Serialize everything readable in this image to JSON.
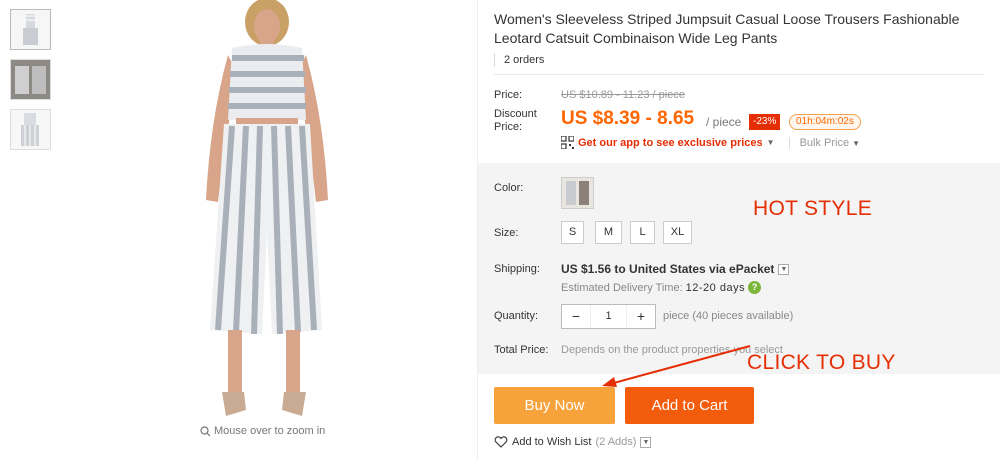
{
  "product": {
    "title": "Women's Sleeveless Striped Jumpsuit Casual Loose Trousers Fashionable Leotard Catsuit Combinaison Wide Leg Pants",
    "orders": "2 orders"
  },
  "gallery": {
    "zoom_hint": "Mouse over to zoom in"
  },
  "pricing": {
    "price_label": "Price:",
    "old_price": "US $10.89 - 11.23 / piece",
    "discount_label": "Discount Price:",
    "new_price": "US $8.39 - 8.65",
    "per_piece": "/ piece",
    "discount_badge": "-23%",
    "timer": "01h:04m:02s",
    "app_promo": "Get our app to see exclusive prices",
    "bulk_price": "Bulk Price"
  },
  "options": {
    "color_label": "Color:",
    "size_label": "Size:",
    "sizes": [
      "S",
      "M",
      "L",
      "XL"
    ],
    "shipping_label": "Shipping:",
    "shipping_value": "US $1.56 to United States via ePacket",
    "delivery_label": "Estimated Delivery Time:",
    "delivery_days": "12-20 days",
    "quantity_label": "Quantity:",
    "quantity_value": "1",
    "quantity_minus": "−",
    "quantity_plus": "+",
    "availability": "piece (40 pieces available)",
    "total_label": "Total Price:",
    "total_note": "Depends on the product properties you select"
  },
  "annotations": {
    "hot_style": "HOT STYLE",
    "click_to_buy": "CLICK TO BUY"
  },
  "actions": {
    "buy_now": "Buy Now",
    "add_to_cart": "Add to Cart",
    "wishlist": "Add to Wish List",
    "wishlist_count": "(2 Adds)"
  },
  "colors": {
    "accent_orange": "#f60",
    "buy_now_bg": "#f7a23b",
    "add_cart_bg": "#f25c0c",
    "annotation_red": "#e62e04"
  }
}
